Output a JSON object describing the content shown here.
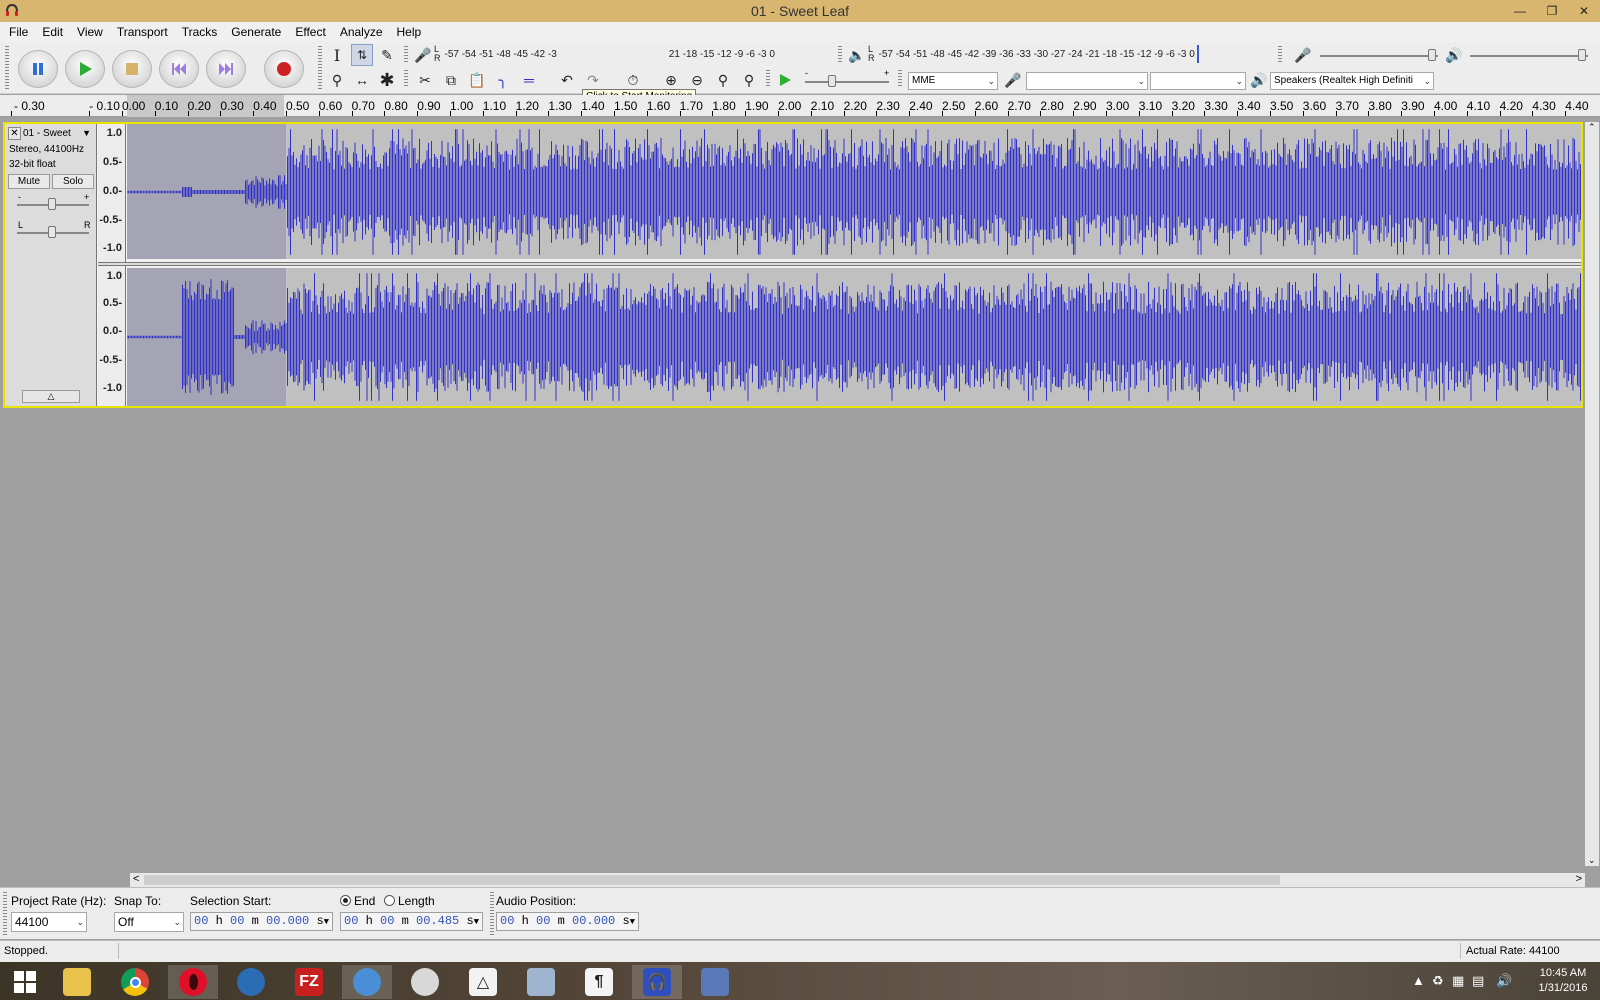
{
  "window": {
    "title": "01 - Sweet Leaf",
    "minimize_icon": "minimize-icon",
    "restore_icon": "restore-icon",
    "close_icon": "close-icon"
  },
  "menu": {
    "items": [
      "File",
      "Edit",
      "View",
      "Transport",
      "Tracks",
      "Generate",
      "Effect",
      "Analyze",
      "Help"
    ]
  },
  "toolbar": {
    "transport_icons": [
      "pause-icon",
      "play-icon",
      "stop-icon",
      "skip-to-start-icon",
      "skip-to-end-icon",
      "record-icon"
    ],
    "record_meter": {
      "channel_top": "L",
      "channel_bottom": "R",
      "scale_left": "-57 -54 -51 -48 -45 -42 -3",
      "scale_right": "21 -18 -15 -12 -9 -6 -3 0"
    },
    "tooltip": "Click to Start Monitoring",
    "playback_meter": {
      "channel_top": "L",
      "channel_bottom": "R",
      "scale": "-57 -54 -51 -48 -45 -42 -39 -36 -33 -30 -27 -24 -21 -18 -15 -12 -9 -6 -3 0"
    },
    "slider_minus": "-",
    "slider_plus": "+",
    "host": "MME",
    "recording_device": "",
    "recording_channels": "",
    "playback_device": "Speakers (Realtek High Definiti"
  },
  "ruler": {
    "labels": [
      "- 0.30",
      "- 0.10",
      "0.00",
      "0.10",
      "0.20",
      "0.30",
      "0.40",
      "0.50",
      "0.60",
      "0.70",
      "0.80",
      "0.90",
      "1.00",
      "1.10",
      "1.20",
      "1.30",
      "1.40",
      "1.50",
      "1.60",
      "1.70",
      "1.80",
      "1.90",
      "2.00",
      "2.10",
      "2.20",
      "2.30",
      "2.40",
      "2.50",
      "2.60",
      "2.70",
      "2.80",
      "2.90",
      "3.00",
      "3.10",
      "3.20",
      "3.30",
      "3.40",
      "3.50",
      "3.60",
      "3.70",
      "3.80",
      "3.90",
      "4.00",
      "4.10",
      "4.20",
      "4.30",
      "4.40"
    ]
  },
  "track": {
    "name": "01 - Sweet",
    "format": "Stereo, 44100Hz",
    "bit_depth": "32-bit float",
    "mute_label": "Mute",
    "solo_label": "Solo",
    "gain_minus": "-",
    "gain_plus": "+",
    "pan_left": "L",
    "pan_right": "R",
    "amplitude_labels": [
      "1.0",
      "0.5-",
      "0.0-",
      "-0.5-",
      "-1.0"
    ],
    "selection": {
      "start_seconds": 0.0,
      "end_seconds": 0.485
    },
    "waveform_color": "#3232c8",
    "selected_bg": "#a4a4b4",
    "unselected_bg": "#c0c0c0"
  },
  "selection_bar": {
    "project_rate_label": "Project Rate (Hz):",
    "project_rate_value": "44100",
    "snap_label": "Snap To:",
    "snap_value": "Off",
    "selection_start_label": "Selection Start:",
    "end_label": "End",
    "length_label": "Length",
    "end_selected": true,
    "selection_start": {
      "h": "00",
      "m": "00",
      "s": "00.000"
    },
    "selection_end": {
      "h": "00",
      "m": "00",
      "s": "00.485"
    },
    "audio_position_label": "Audio Position:",
    "audio_position": {
      "h": "00",
      "m": "00",
      "s": "00.000"
    },
    "unit_h": "h",
    "unit_m": "m",
    "unit_s": "s"
  },
  "status": {
    "left": "Stopped.",
    "right": "Actual Rate: 44100"
  },
  "taskbar": {
    "apps": [
      "windows-start-icon",
      "file-explorer-icon",
      "chrome-icon",
      "opera-icon",
      "thunderbird-icon",
      "filezilla-icon",
      "system-tool-icon",
      "media-player-icon",
      "metronome-icon",
      "calculator-icon",
      "word-processor-icon",
      "audacity-icon",
      "design-app-icon"
    ],
    "filezilla_glyph": "FZ",
    "wordpad_glyph": "¶",
    "active_app": "audacity-icon",
    "time": "10:45 AM",
    "date": "1/31/2016"
  }
}
